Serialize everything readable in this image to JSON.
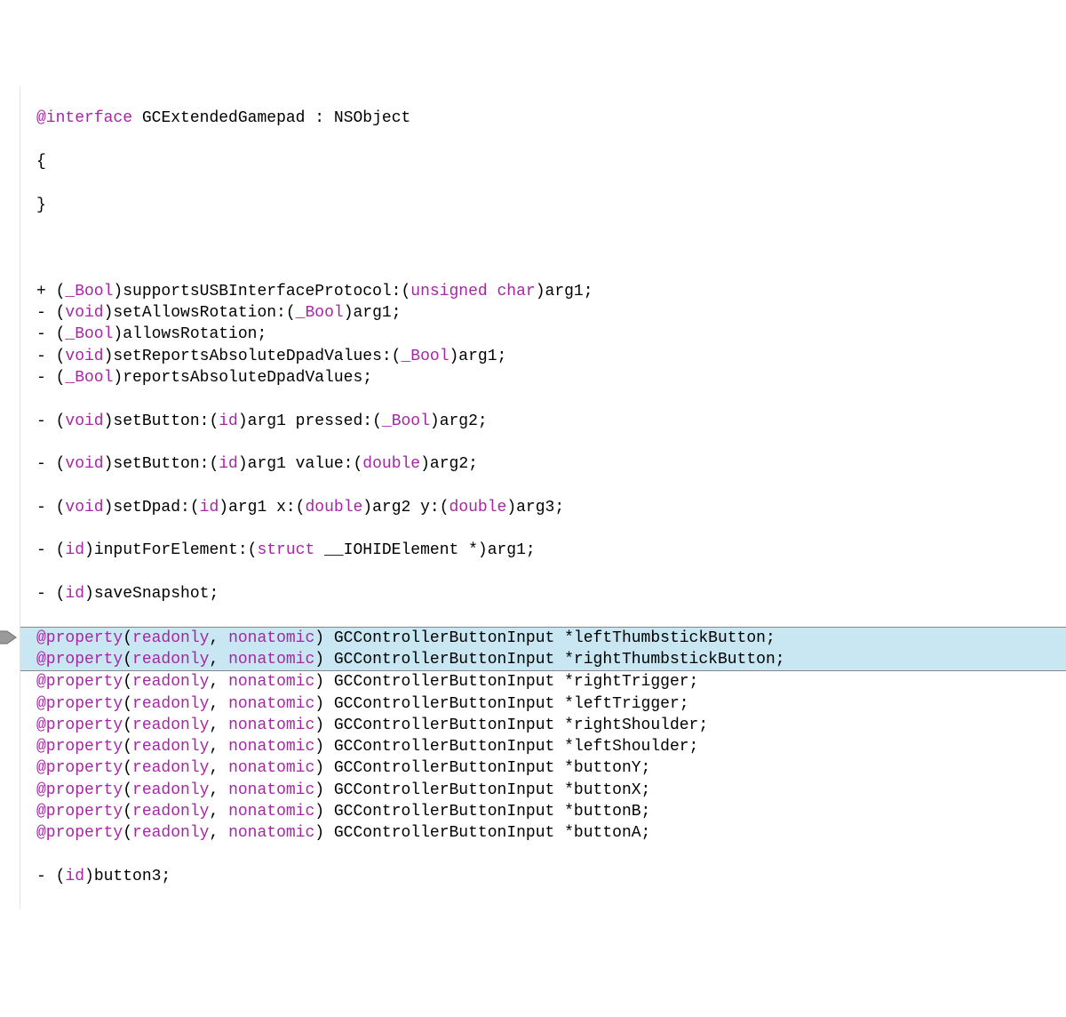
{
  "interface_decl": {
    "directive": "@interface",
    "name": "GCExtendedGamepad",
    "super": "NSObject"
  },
  "braces": {
    "open": "{",
    "close": "}"
  },
  "methods_top": [
    {
      "sig_prefix": "+ (",
      "kw": "_Bool",
      "tail": ")supportsUSBInterfaceProtocol:(",
      "kw2": "unsigned char",
      "tail2": ")arg1;"
    },
    {
      "sig_prefix": "- (",
      "kw": "void",
      "tail": ")setAllowsRotation:(",
      "kw2": "_Bool",
      "tail2": ")arg1;"
    },
    {
      "sig_prefix": "- (",
      "kw": "_Bool",
      "tail": ")allowsRotation;",
      "kw2": "",
      "tail2": ""
    },
    {
      "sig_prefix": "- (",
      "kw": "void",
      "tail": ")setReportsAbsoluteDpadValues:(",
      "kw2": "_Bool",
      "tail2": ")arg1;"
    },
    {
      "sig_prefix": "- (",
      "kw": "_Bool",
      "tail": ")reportsAbsoluteDpadValues;",
      "kw2": "",
      "tail2": ""
    }
  ],
  "setButton_pressed": {
    "prefix": "- (",
    "kw": "void",
    "mid": ")setButton:(",
    "kw2": "id",
    "mid2": ")arg1 pressed:(",
    "kw3": "_Bool",
    "tail": ")arg2;"
  },
  "setButton_value": {
    "prefix": "- (",
    "kw": "void",
    "mid": ")setButton:(",
    "kw2": "id",
    "mid2": ")arg1 value:(",
    "kw3": "double",
    "tail": ")arg2;"
  },
  "setDpad": {
    "prefix": "- (",
    "kw": "void",
    "mid": ")setDpad:(",
    "kw2": "id",
    "mid2": ")arg1 x:(",
    "kw3": "double",
    "mid3": ")arg2 y:(",
    "kw4": "double",
    "tail": ")arg3;"
  },
  "inputForElement": {
    "prefix": "- (",
    "kw": "id",
    "mid": ")inputForElement:(",
    "kw2": "struct",
    "tail": " __IOHIDElement *)arg1;"
  },
  "saveSnapshot": {
    "prefix": "- (",
    "kw": "id",
    "tail": ")saveSnapshot;"
  },
  "properties": [
    {
      "name": "leftThumbstickButton",
      "hl": true,
      "pos": "top"
    },
    {
      "name": "rightThumbstickButton",
      "hl": true,
      "pos": "bot"
    },
    {
      "name": "rightTrigger",
      "hl": false,
      "pos": ""
    },
    {
      "name": "leftTrigger",
      "hl": false,
      "pos": ""
    },
    {
      "name": "rightShoulder",
      "hl": false,
      "pos": ""
    },
    {
      "name": "leftShoulder",
      "hl": false,
      "pos": ""
    },
    {
      "name": "buttonY",
      "hl": false,
      "pos": ""
    },
    {
      "name": "buttonX",
      "hl": false,
      "pos": ""
    },
    {
      "name": "buttonB",
      "hl": false,
      "pos": ""
    },
    {
      "name": "buttonA",
      "hl": false,
      "pos": ""
    }
  ],
  "prop_tokens": {
    "directive": "@property",
    "lp": "(",
    "readonly": "readonly",
    "comma": ", ",
    "nonatomic": "nonatomic",
    "rp": ") ",
    "retType": "GCControllerButtonInput *",
    "semi": ";"
  },
  "button3": {
    "prefix": "- (",
    "kw": "id",
    "tail": ")button3;"
  }
}
